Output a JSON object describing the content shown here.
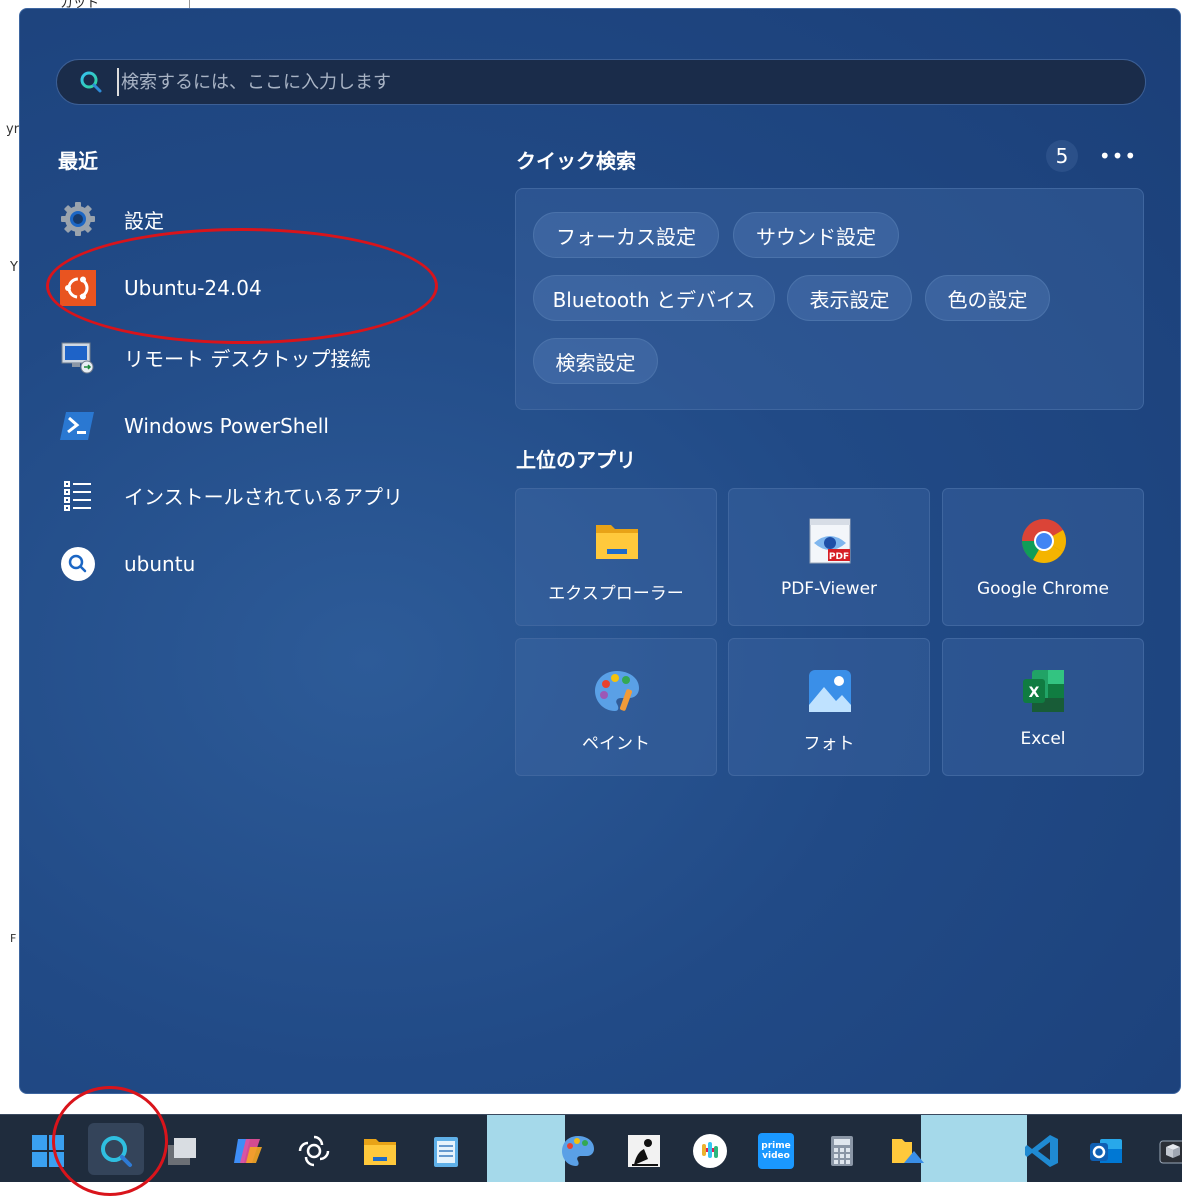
{
  "background": {
    "top_fragment": "カット",
    "left_fragments": [
      "yr",
      "Y",
      "F"
    ]
  },
  "search": {
    "placeholder": "検索するには、ここに入力します"
  },
  "recent": {
    "title": "最近",
    "items": [
      {
        "label": "設定",
        "icon": "settings-gear-icon"
      },
      {
        "label": "Ubuntu-24.04",
        "icon": "ubuntu-icon"
      },
      {
        "label": "リモート デスクトップ接続",
        "icon": "remote-desktop-icon"
      },
      {
        "label": "Windows PowerShell",
        "icon": "powershell-icon"
      },
      {
        "label": "インストールされているアプリ",
        "icon": "installed-apps-list-icon"
      },
      {
        "label": "ubuntu",
        "icon": "web-search-icon"
      }
    ]
  },
  "quick_search": {
    "title": "クイック検索",
    "count": "5",
    "more_label": "•••",
    "chips": [
      "フォーカス設定",
      "サウンド設定",
      "Bluetooth とデバイス",
      "表示設定",
      "色の設定",
      "検索設定"
    ]
  },
  "top_apps": {
    "title": "上位のアプリ",
    "apps": [
      {
        "label": "エクスプローラー",
        "icon": "file-explorer-icon"
      },
      {
        "label": "PDF-Viewer",
        "icon": "pdf-viewer-icon"
      },
      {
        "label": "Google Chrome",
        "icon": "chrome-icon"
      },
      {
        "label": "ペイント",
        "icon": "paint-icon"
      },
      {
        "label": "フォト",
        "icon": "photos-icon"
      },
      {
        "label": "Excel",
        "icon": "excel-icon"
      }
    ]
  },
  "taskbar": {
    "icons": [
      "windows-start-icon",
      "search-icon",
      "task-view-icon",
      "copilot-icon",
      "chatgpt-icon",
      "file-explorer-icon",
      "notepad-icon",
      "paint-icon",
      "kindle-icon",
      "slack-icon",
      "prime-video-icon",
      "calculator-icon",
      "photos-icon",
      "vscode-icon",
      "outlook-icon",
      "sandbox-icon"
    ],
    "prime_video_text": "prime video"
  },
  "colors": {
    "panel": "#214a86",
    "annotation": "#d9141b",
    "ubuntu_orange": "#e95420"
  }
}
